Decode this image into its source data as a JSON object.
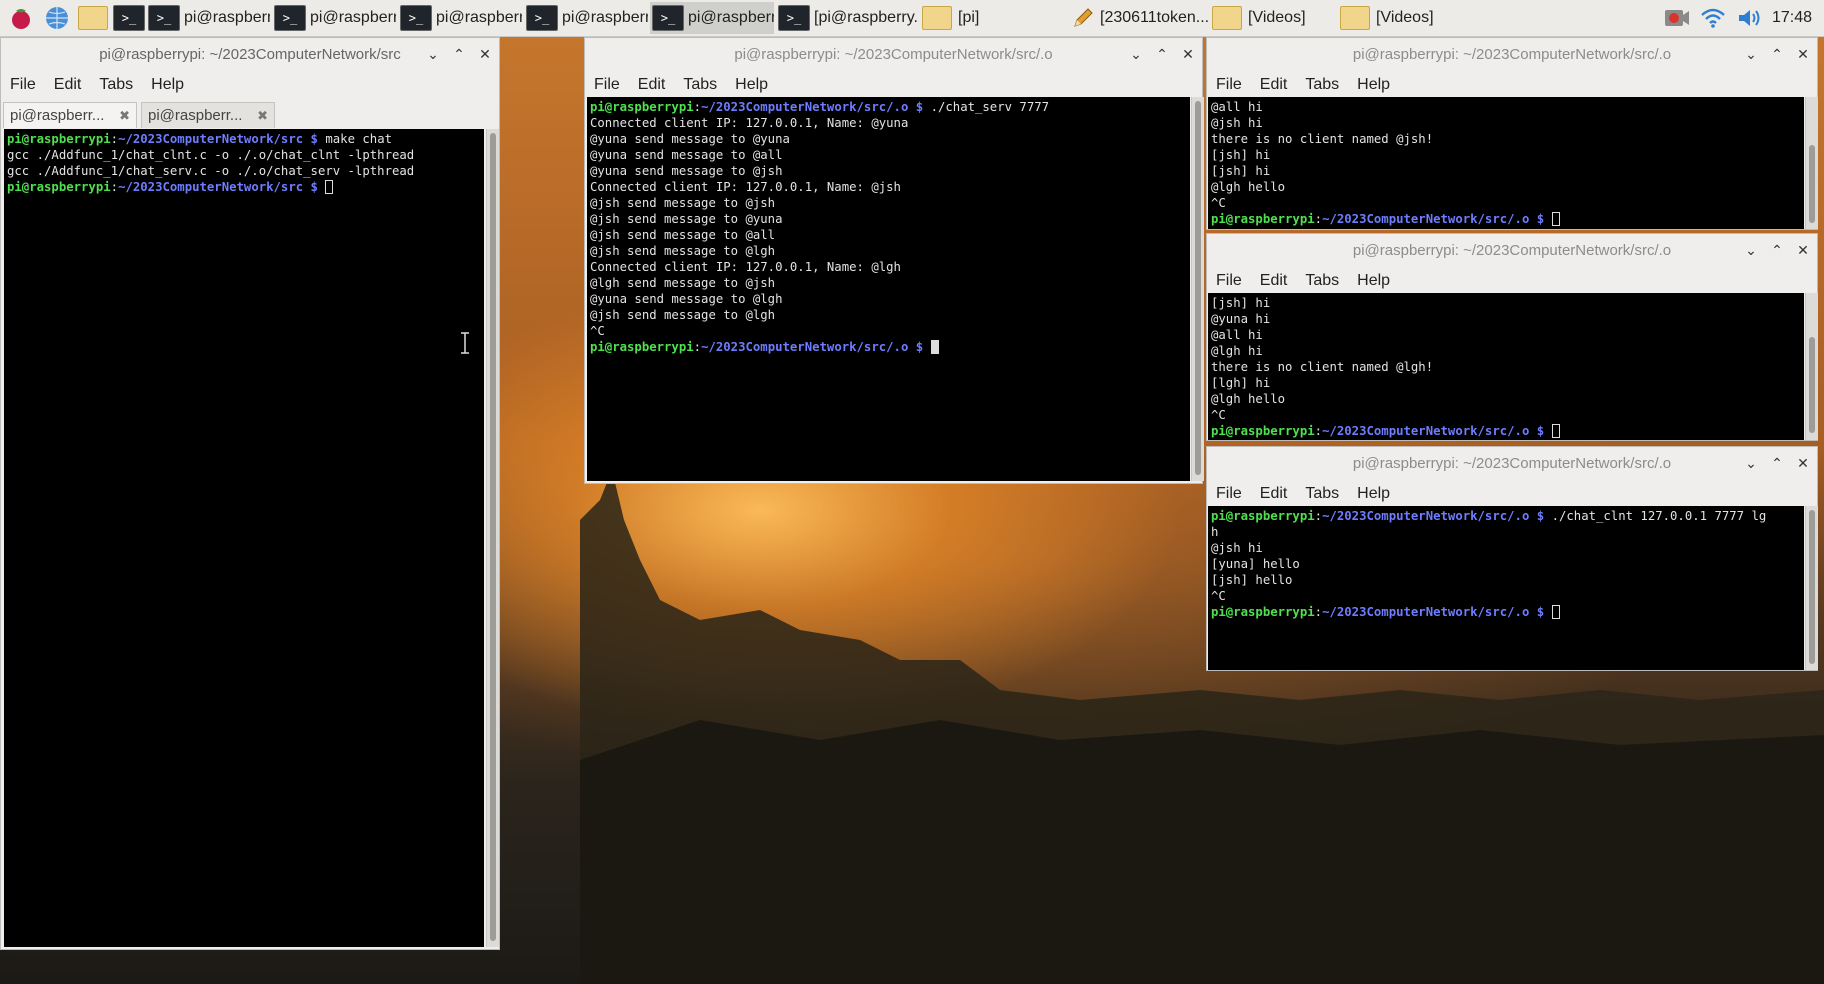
{
  "taskbar": {
    "buttons": [
      {
        "label": "pi@raspberry...",
        "icon": "terminal-icon"
      },
      {
        "label": "pi@raspberry...",
        "icon": "terminal-icon"
      },
      {
        "label": "pi@raspberry...",
        "icon": "terminal-icon"
      },
      {
        "label": "pi@raspberry...",
        "icon": "terminal-icon"
      },
      {
        "label": "pi@raspberry...",
        "icon": "terminal-icon"
      },
      {
        "label": "[pi@raspberry...",
        "icon": "terminal-icon"
      },
      {
        "label": "[pi]",
        "icon": "folder-icon"
      },
      {
        "label": "[230611token...",
        "icon": "pencil-icon"
      },
      {
        "label": "[Videos]",
        "icon": "folder-icon"
      },
      {
        "label": "[Videos]",
        "icon": "folder-icon"
      }
    ],
    "clock": "17:48"
  },
  "menu": {
    "file": "File",
    "edit": "Edit",
    "tabs": "Tabs",
    "help": "Help"
  },
  "prompt": {
    "user": "pi@raspberrypi",
    "sep": ":",
    "dollar": " $ "
  },
  "win1": {
    "title": "pi@raspberrypi: ~/2023ComputerNetwork/src",
    "tabs": [
      "pi@raspberr...",
      "pi@raspberr..."
    ],
    "path": "~/2023ComputerNetwork/src",
    "cmd": "make chat",
    "out": [
      "gcc ./Addfunc_1/chat_clnt.c -o ./.o/chat_clnt -lpthread",
      "gcc ./Addfunc_1/chat_serv.c -o ./.o/chat_serv -lpthread"
    ]
  },
  "win2": {
    "title": "pi@raspberrypi: ~/2023ComputerNetwork/src/.o",
    "path": "~/2023ComputerNetwork/src/.o",
    "cmd": "./chat_serv 7777",
    "out": [
      "Connected client IP: 127.0.0.1, Name: @yuna",
      "@yuna send message to @yuna",
      "@yuna send message to @all",
      "@yuna send message to @jsh",
      "Connected client IP: 127.0.0.1, Name: @jsh",
      "@jsh send message to @jsh",
      "@jsh send message to @yuna",
      "@jsh send message to @all",
      "@jsh send message to @lgh",
      "Connected client IP: 127.0.0.1, Name: @lgh",
      "@lgh send message to @jsh",
      "@yuna send message to @lgh",
      "@jsh send message to @lgh",
      "^C"
    ]
  },
  "win3": {
    "title": "pi@raspberrypi: ~/2023ComputerNetwork/src/.o",
    "path": "~/2023ComputerNetwork/src/.o",
    "out": [
      "@all hi",
      "@jsh hi",
      "there is no client named @jsh!",
      "[jsh] hi",
      "[jsh] hi",
      "@lgh hello",
      "^C"
    ]
  },
  "win4": {
    "title": "pi@raspberrypi: ~/2023ComputerNetwork/src/.o",
    "path": "~/2023ComputerNetwork/src/.o",
    "out": [
      "[jsh] hi",
      "@yuna hi",
      "@all hi",
      "@lgh hi",
      "there is no client named @lgh!",
      "[lgh] hi",
      "@lgh hello",
      "^C"
    ]
  },
  "win5": {
    "title": "pi@raspberrypi: ~/2023ComputerNetwork/src/.o",
    "path": "~/2023ComputerNetwork/src/.o",
    "cmd": "./chat_clnt 127.0.0.1 7777 lg",
    "cmd_wrap": "h",
    "out": [
      "@jsh hi",
      "[yuna] hello",
      "[jsh] hello",
      "^C"
    ]
  },
  "colors": {
    "prompt_user": "#4ee04e",
    "prompt_path": "#6e7cff",
    "terminal_bg": "#000000",
    "terminal_fg": "#e3e3e3"
  }
}
